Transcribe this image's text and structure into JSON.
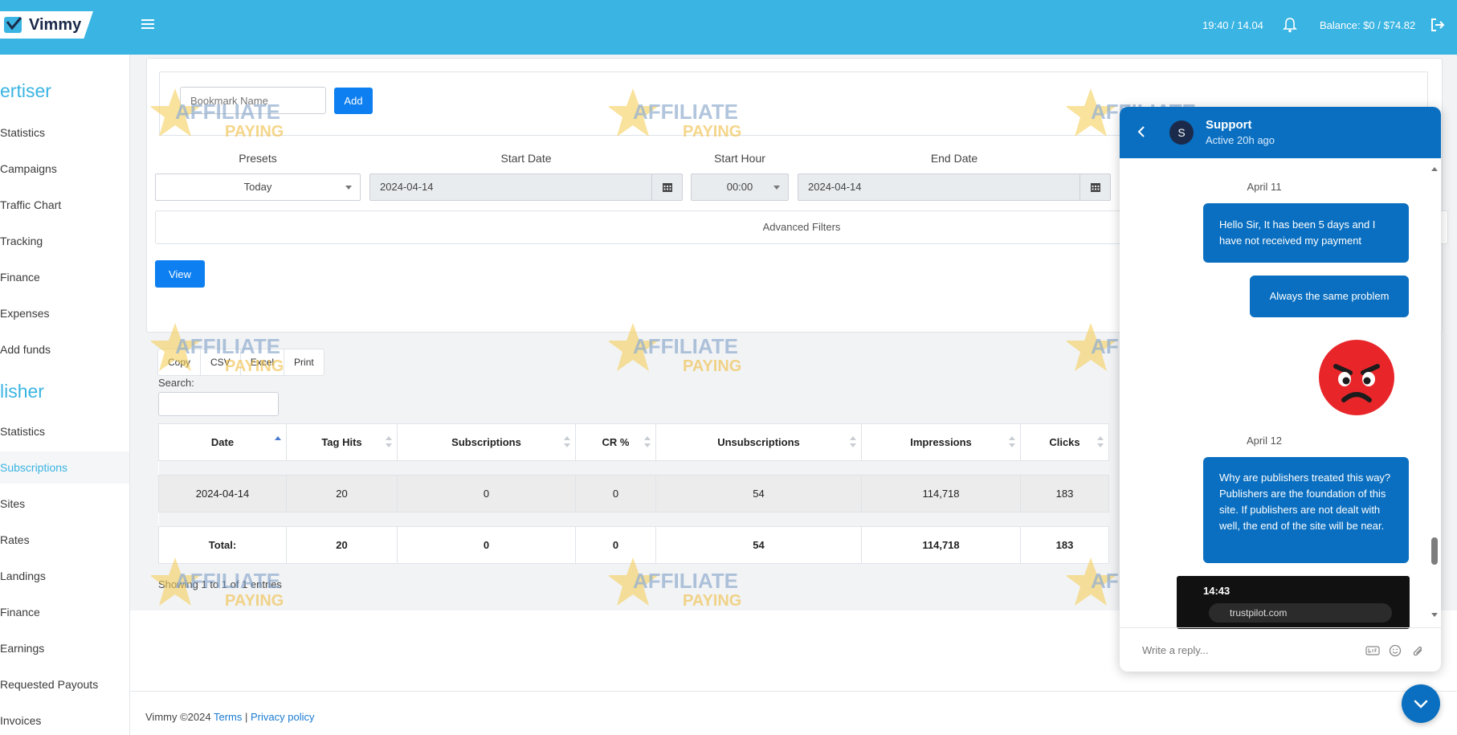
{
  "header": {
    "logo_text": "Vimmy",
    "clock": "19:40 / 14.04",
    "balance": "Balance: $0 / $74.82"
  },
  "sidebar": {
    "advertiser_title": "ertiser",
    "advertiser_items": [
      "Statistics",
      "Campaigns",
      "Traffic Chart",
      "Tracking",
      "Finance",
      "Expenses",
      "Add funds"
    ],
    "publisher_title": "lisher",
    "publisher_items": [
      "Statistics",
      "Subscriptions",
      "Sites",
      "Rates",
      "Landings",
      "Finance",
      "Earnings",
      "Requested Payouts",
      "Invoices"
    ]
  },
  "bookmark": {
    "placeholder": "Bookmark Name",
    "add_label": "Add"
  },
  "filters": {
    "presets_label": "Presets",
    "presets_value": "Today",
    "start_date_label": "Start Date",
    "start_date_value": "2024-04-14",
    "start_hour_label": "Start Hour",
    "start_hour_value": "00:00",
    "end_date_label": "End Date",
    "end_date_value": "2024-04-14",
    "advanced_label": "Advanced Filters",
    "view_label": "View"
  },
  "export": [
    "Copy",
    "CSV",
    "Excel",
    "Print"
  ],
  "search_label": "Search:",
  "table": {
    "columns": [
      "Date",
      "Tag Hits",
      "Subscriptions",
      "CR %",
      "Unsubscriptions",
      "Impressions",
      "Clicks"
    ],
    "rows": [
      [
        "2024-04-14",
        "20",
        "0",
        "0",
        "54",
        "114,718",
        "183"
      ]
    ],
    "total": [
      "Total:",
      "20",
      "0",
      "0",
      "54",
      "114,718",
      "183"
    ]
  },
  "showing": "Showing 1 to 1 of 1 entries",
  "footer": {
    "copyright": "Vimmy ©2024",
    "terms": "Terms",
    "separator": "|",
    "privacy": "Privacy policy"
  },
  "watermark": {
    "line1": "AFFILIATE",
    "line2": "PAYING"
  },
  "chat": {
    "agent_initial": "S",
    "agent_name": "Support",
    "agent_status": "Active 20h ago",
    "date1": "April 11",
    "msg1": "Hello Sir, It has been 5 days and I have not received my payment",
    "msg2": "Always the same problem",
    "date2": "April 12",
    "msg3": "Why are publishers treated this way? Publishers are the foundation of this site. If publishers are not dealt with well, the end of the site will be near.",
    "shot_time": "14:43",
    "shot_url": "trustpilot.com",
    "reply_placeholder": "Write a reply..."
  },
  "colors": {
    "header": "#3ab4e2",
    "primary": "#0d7ff0",
    "chat": "#0a6fc0"
  }
}
